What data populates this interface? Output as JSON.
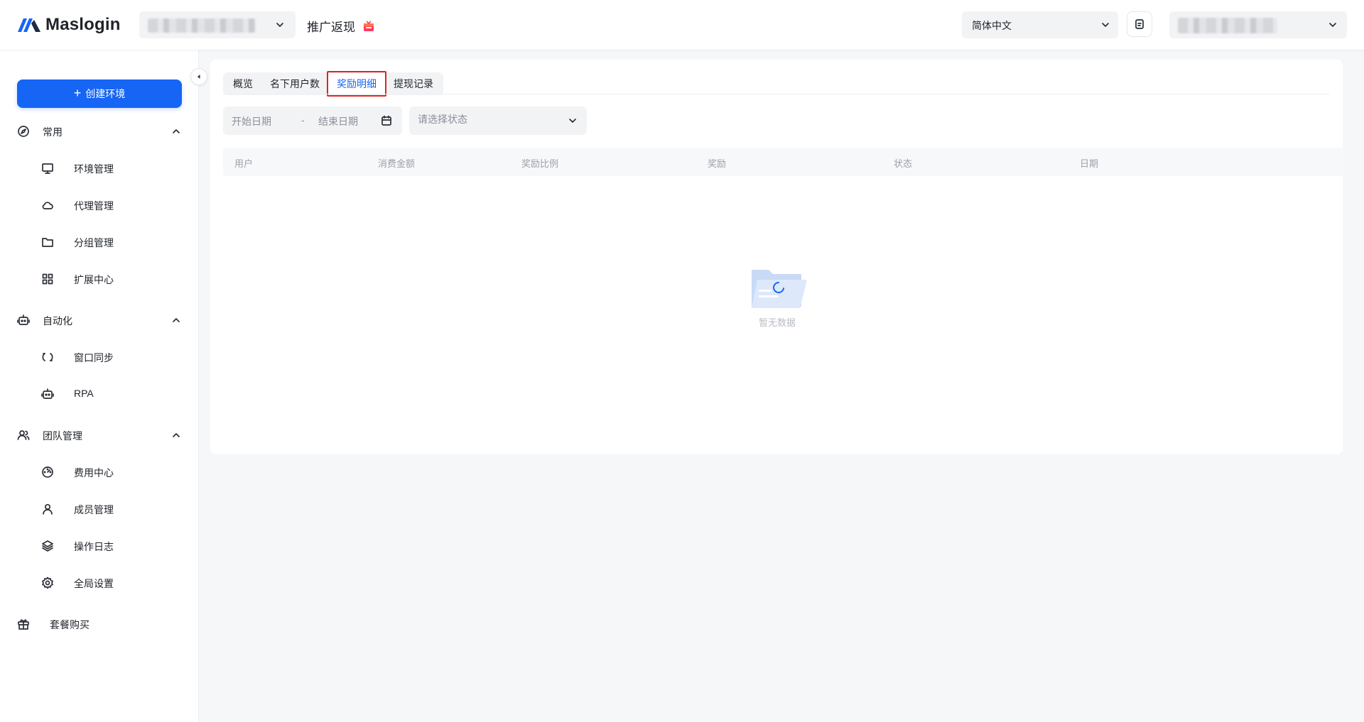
{
  "app": {
    "name": "Maslogin",
    "page_title": "推广返现"
  },
  "header": {
    "language_selected": "简体中文"
  },
  "sidebar": {
    "create_button": "创建环境",
    "groups": [
      {
        "label": "常用",
        "items": [
          "环境管理",
          "代理管理",
          "分组管理",
          "扩展中心"
        ]
      },
      {
        "label": "自动化",
        "items": [
          "窗口同步",
          "RPA"
        ]
      },
      {
        "label": "团队管理",
        "items": [
          "费用中心",
          "成员管理",
          "操作日志",
          "全局设置"
        ]
      }
    ],
    "solo_item": "套餐购买"
  },
  "tabs": [
    {
      "label": "概览",
      "active": false
    },
    {
      "label": "名下用户数",
      "active": false
    },
    {
      "label": "奖励明细",
      "active": true
    },
    {
      "label": "提现记录",
      "active": false
    }
  ],
  "filters": {
    "start_date_placeholder": "开始日期",
    "separator": "-",
    "end_date_placeholder": "结束日期",
    "status_placeholder": "请选择状态"
  },
  "table": {
    "columns": [
      "用户",
      "消费金额",
      "奖励比例",
      "奖励",
      "状态",
      "日期"
    ],
    "rows": [],
    "empty_text": "暂无数据"
  },
  "colors": {
    "primary": "#1665f5",
    "highlight_border": "#e02424"
  }
}
